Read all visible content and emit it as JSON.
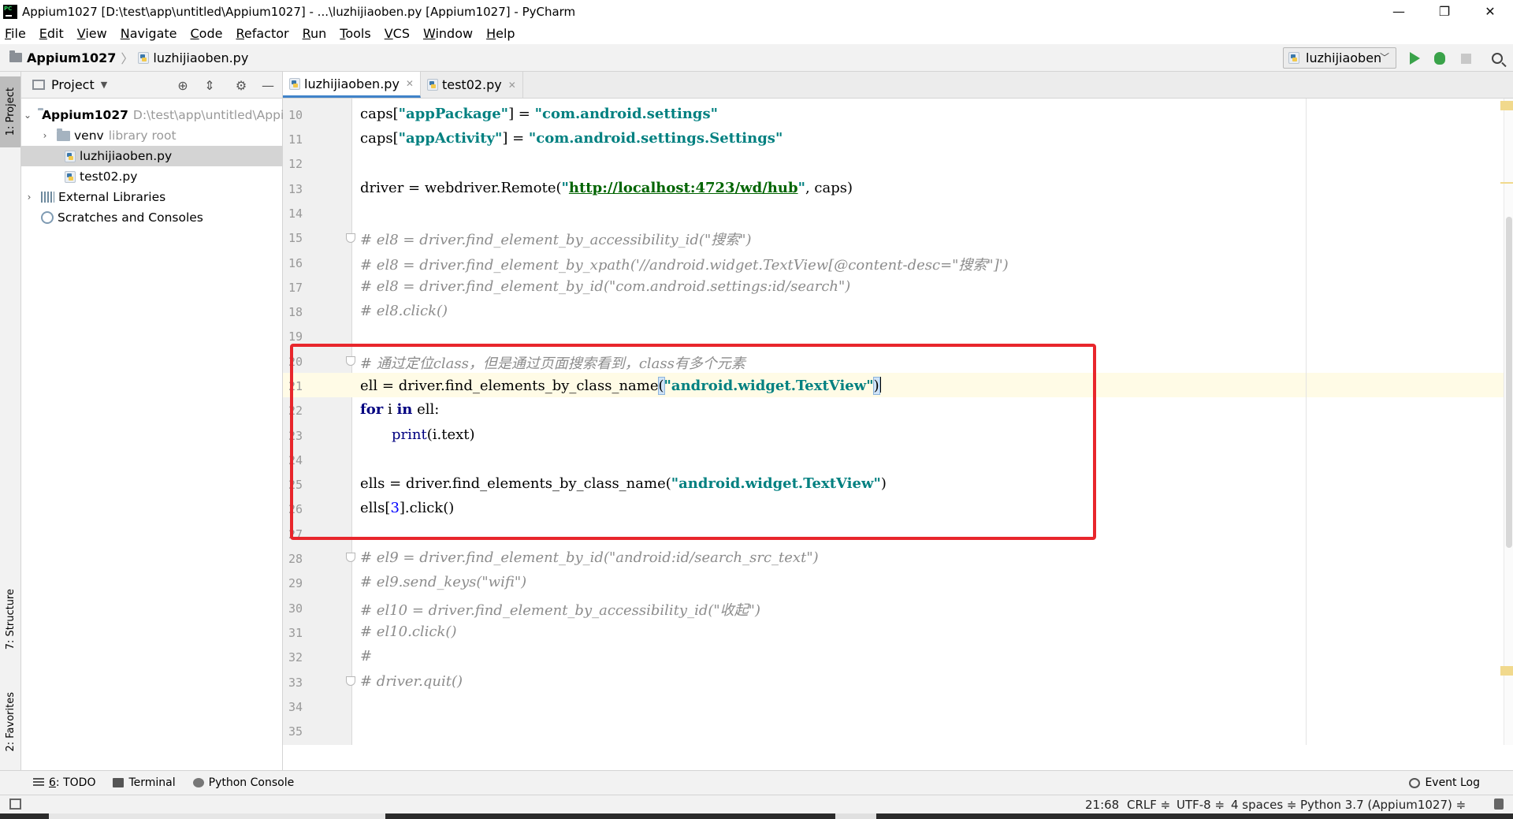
{
  "window": {
    "title": "Appium1027 [D:\\test\\app\\untitled\\Appium1027] - ...\\luzhijiaoben.py [Appium1027] - PyCharm",
    "minimize": "—",
    "restore": "❐",
    "close": "✕"
  },
  "menu": {
    "items": [
      {
        "u": "F",
        "rest": "ile"
      },
      {
        "u": "E",
        "rest": "dit"
      },
      {
        "u": "V",
        "rest": "iew"
      },
      {
        "u": "N",
        "rest": "avigate"
      },
      {
        "u": "C",
        "rest": "ode"
      },
      {
        "u": "R",
        "rest": "efactor"
      },
      {
        "u": "R",
        "rest": "un"
      },
      {
        "u": "T",
        "rest": "ools"
      },
      {
        "u": "V",
        "rest": "CS"
      },
      {
        "u": "W",
        "rest": "indow"
      },
      {
        "u": "H",
        "rest": "elp"
      }
    ]
  },
  "navbar": {
    "project": "Appium1027",
    "file": "luzhijiaoben.py",
    "run_config": "luzhijiaoben"
  },
  "left_strip": {
    "project": "1: Project",
    "structure": "7: Structure",
    "favorites": "2: Favorites"
  },
  "project_panel": {
    "title": "Project",
    "tree": {
      "root_name": "Appium1027",
      "root_path": "D:\\test\\app\\untitled\\Appium1027",
      "venv": "venv",
      "venv_hint": "library root",
      "file1": "luzhijiaoben.py",
      "file2": "test02.py",
      "ext_libs": "External Libraries",
      "scratches": "Scratches and Consoles"
    }
  },
  "tabs": {
    "tab1": "luzhijiaoben.py",
    "tab2": "test02.py"
  },
  "editor": {
    "line_numbers": [
      "10",
      "11",
      "12",
      "13",
      "14",
      "15",
      "16",
      "17",
      "18",
      "19",
      "20",
      "21",
      "22",
      "23",
      "24",
      "25",
      "26",
      "27",
      "28",
      "29",
      "30",
      "31",
      "32",
      "33",
      "34",
      "35"
    ],
    "l10": {
      "a": "caps[",
      "b": "\"appPackage\"",
      "c": "] = ",
      "d": "\"com.android.settings\""
    },
    "l11": {
      "a": "caps[",
      "b": "\"appActivity\"",
      "c": "] = ",
      "d": "\"com.android.settings.Settings\""
    },
    "l13": {
      "a": "driver = webdriver.Remote(",
      "b": "\"",
      "url": "http://localhost:4723/wd/hub",
      "c": "\"",
      "d": ", caps)"
    },
    "l15": "# el8 = driver.find_element_by_accessibility_id(\"搜索\")",
    "l16": "# el8 = driver.find_element_by_xpath('//android.widget.TextView[@content-desc=\"搜索\"]')",
    "l17": "# el8 = driver.find_element_by_id(\"com.android.settings:id/search\")",
    "l18": "# el8.click()",
    "l20": "# 通过定位class，但是通过页面搜索看到，class有多个元素",
    "l21": {
      "a": "ell = driver.find_elements_by_class_name",
      "b": "(",
      "c": "\"android.widget.TextView\"",
      "d": ")"
    },
    "l22": {
      "kw1": "for",
      "a": " i ",
      "kw2": "in",
      "b": " ell:"
    },
    "l23": {
      "fn": "print",
      "a": "(i.text)"
    },
    "l25": {
      "a": "ells = driver.find_elements_by_class_name(",
      "b": "\"android.widget.TextView\"",
      "c": ")"
    },
    "l26": {
      "a": "ells[",
      "n": "3",
      "b": "].click()"
    },
    "l28": "# el9 = driver.find_element_by_id(\"android:id/search_src_text\")",
    "l29": "# el9.send_keys(\"wifi\")",
    "l30": "# el10 = driver.find_element_by_accessibility_id(\"收起\")",
    "l31": "# el10.click()",
    "l32": "#",
    "l33": "# driver.quit()"
  },
  "bottom_tools": {
    "todo_u": "6",
    "todo": ": TODO",
    "terminal": "Terminal",
    "python_console": "Python Console",
    "event_log": "Event Log"
  },
  "status": {
    "position": "21:68",
    "line_sep": "CRLF ≑",
    "encoding": "UTF-8 ≑",
    "indent": "4 spaces ≑",
    "interpreter": "Python 3.7 (Appium1027) ≑"
  }
}
